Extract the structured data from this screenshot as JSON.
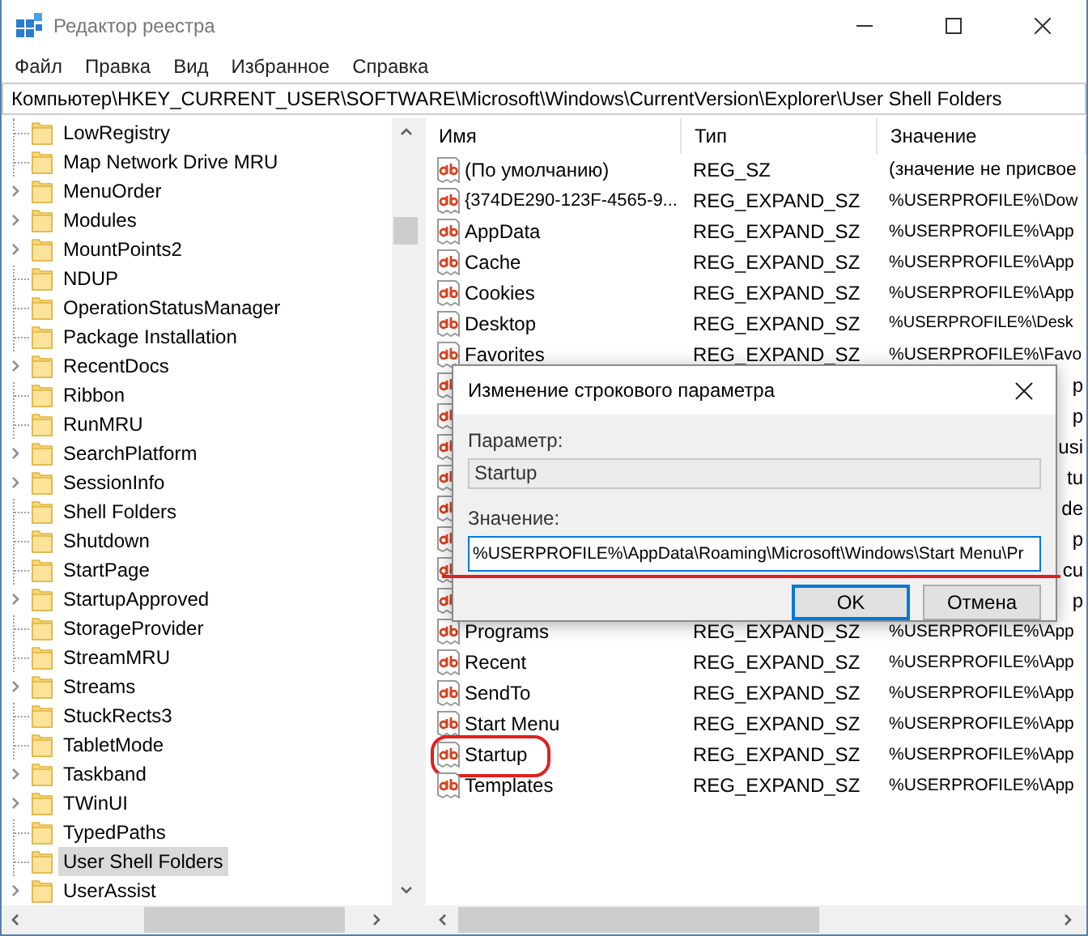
{
  "window": {
    "title": "Редактор реестра"
  },
  "menu": [
    "Файл",
    "Правка",
    "Вид",
    "Избранное",
    "Справка"
  ],
  "address": "Компьютер\\HKEY_CURRENT_USER\\SOFTWARE\\Microsoft\\Windows\\CurrentVersion\\Explorer\\User Shell Folders",
  "tree": {
    "items": [
      {
        "label": "LowRegistry",
        "expandable": false,
        "selected": false
      },
      {
        "label": "Map Network Drive MRU",
        "expandable": false,
        "selected": false
      },
      {
        "label": "MenuOrder",
        "expandable": true,
        "selected": false
      },
      {
        "label": "Modules",
        "expandable": true,
        "selected": false
      },
      {
        "label": "MountPoints2",
        "expandable": true,
        "selected": false
      },
      {
        "label": "NDUP",
        "expandable": false,
        "selected": false
      },
      {
        "label": "OperationStatusManager",
        "expandable": false,
        "selected": false
      },
      {
        "label": "Package Installation",
        "expandable": false,
        "selected": false
      },
      {
        "label": "RecentDocs",
        "expandable": true,
        "selected": false
      },
      {
        "label": "Ribbon",
        "expandable": false,
        "selected": false
      },
      {
        "label": "RunMRU",
        "expandable": false,
        "selected": false
      },
      {
        "label": "SearchPlatform",
        "expandable": true,
        "selected": false
      },
      {
        "label": "SessionInfo",
        "expandable": true,
        "selected": false
      },
      {
        "label": "Shell Folders",
        "expandable": false,
        "selected": false
      },
      {
        "label": "Shutdown",
        "expandable": false,
        "selected": false
      },
      {
        "label": "StartPage",
        "expandable": false,
        "selected": false
      },
      {
        "label": "StartupApproved",
        "expandable": true,
        "selected": false
      },
      {
        "label": "StorageProvider",
        "expandable": false,
        "selected": false
      },
      {
        "label": "StreamMRU",
        "expandable": false,
        "selected": false
      },
      {
        "label": "Streams",
        "expandable": true,
        "selected": false
      },
      {
        "label": "StuckRects3",
        "expandable": false,
        "selected": false
      },
      {
        "label": "TabletMode",
        "expandable": false,
        "selected": false
      },
      {
        "label": "Taskband",
        "expandable": true,
        "selected": false
      },
      {
        "label": "TWinUI",
        "expandable": true,
        "selected": false
      },
      {
        "label": "TypedPaths",
        "expandable": false,
        "selected": false
      },
      {
        "label": "User Shell Folders",
        "expandable": false,
        "selected": true
      },
      {
        "label": "UserAssist",
        "expandable": true,
        "selected": false
      }
    ]
  },
  "values": {
    "columns": [
      "Имя",
      "Тип",
      "Значение"
    ],
    "rows": [
      {
        "kind": "full",
        "name": "(По умолчанию)",
        "type": "REG_SZ",
        "data": "(значение не присвое",
        "circled": false
      },
      {
        "kind": "full",
        "name": "{374DE290-123F-4565-9...",
        "type": "REG_EXPAND_SZ",
        "data": "%USERPROFILE%\\Dow",
        "circled": false
      },
      {
        "kind": "full",
        "name": "AppData",
        "type": "REG_EXPAND_SZ",
        "data": "%USERPROFILE%\\App",
        "circled": false
      },
      {
        "kind": "full",
        "name": "Cache",
        "type": "REG_EXPAND_SZ",
        "data": "%USERPROFILE%\\App",
        "circled": false
      },
      {
        "kind": "full",
        "name": "Cookies",
        "type": "REG_EXPAND_SZ",
        "data": "%USERPROFILE%\\App",
        "circled": false
      },
      {
        "kind": "full",
        "name": "Desktop",
        "type": "REG_EXPAND_SZ",
        "data": "%USERPROFILE%\\Desk",
        "circled": false
      },
      {
        "kind": "full",
        "name": "Favorites",
        "type": "REG_EXPAND_SZ",
        "data": "%USERPROFILE%\\Favo",
        "circled": false
      },
      {
        "kind": "covered",
        "data_tail": "p"
      },
      {
        "kind": "covered",
        "data_tail": "p"
      },
      {
        "kind": "covered",
        "data_tail": "usi"
      },
      {
        "kind": "covered",
        "data_tail": "tu"
      },
      {
        "kind": "covered",
        "data_tail": "de"
      },
      {
        "kind": "covered",
        "data_tail": "p"
      },
      {
        "kind": "covered",
        "data_tail": "cu"
      },
      {
        "kind": "covered",
        "data_tail": "p"
      },
      {
        "kind": "full",
        "name": "Programs",
        "type": "REG_EXPAND_SZ",
        "data": "%USERPROFILE%\\App",
        "circled": false
      },
      {
        "kind": "full",
        "name": "Recent",
        "type": "REG_EXPAND_SZ",
        "data": "%USERPROFILE%\\App",
        "circled": false
      },
      {
        "kind": "full",
        "name": "SendTo",
        "type": "REG_EXPAND_SZ",
        "data": "%USERPROFILE%\\App",
        "circled": false
      },
      {
        "kind": "full",
        "name": "Start Menu",
        "type": "REG_EXPAND_SZ",
        "data": "%USERPROFILE%\\App",
        "circled": false
      },
      {
        "kind": "full",
        "name": "Startup",
        "type": "REG_EXPAND_SZ",
        "data": "%USERPROFILE%\\App",
        "circled": true
      },
      {
        "kind": "full",
        "name": "Templates",
        "type": "REG_EXPAND_SZ",
        "data": "%USERPROFILE%\\App",
        "circled": false
      }
    ]
  },
  "dialog": {
    "title": "Изменение строкового параметра",
    "param_label": "Параметр:",
    "param_value": "Startup",
    "value_label": "Значение:",
    "value": "%USERPROFILE%\\AppData\\Roaming\\Microsoft\\Windows\\Start Menu\\Pr",
    "value_underlined": true,
    "buttons": [
      {
        "label": "OK",
        "default": true
      },
      {
        "label": "Отмена",
        "default": false
      }
    ]
  }
}
